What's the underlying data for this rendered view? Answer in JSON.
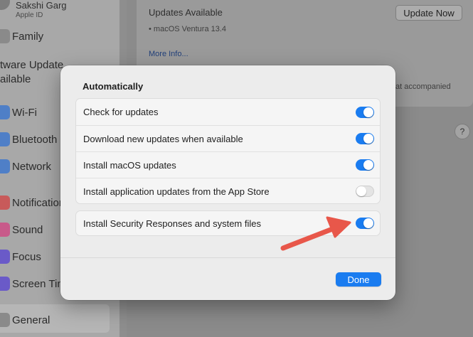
{
  "sidebar": {
    "user_name": "Sakshi Garg",
    "user_sub": "Apple ID",
    "family": "Family",
    "software_update_line1": "tware Update",
    "software_update_line2": "ailable",
    "items": [
      {
        "label": "Wi-Fi",
        "icon": "wifi-icon",
        "color": "#4f7fc7"
      },
      {
        "label": "Bluetooth",
        "icon": "bluetooth-icon",
        "color": "#4f7fc7"
      },
      {
        "label": "Network",
        "icon": "network-icon",
        "color": "#4f7fc7"
      },
      {
        "label": "Notification",
        "icon": "notifications-icon",
        "color": "#c85a5a"
      },
      {
        "label": "Sound",
        "icon": "sound-icon",
        "color": "#c85a8a"
      },
      {
        "label": "Focus",
        "icon": "focus-icon",
        "color": "#6a5ac8"
      },
      {
        "label": "Screen Tim",
        "icon": "screen-time-icon",
        "color": "#6a5ac8"
      },
      {
        "label": "General",
        "icon": "general-icon",
        "color": "#8a8a8a"
      }
    ]
  },
  "main": {
    "updates_title": "Updates Available",
    "updates_sub": "• macOS Ventura 13.4",
    "more_info": "More Info...",
    "update_now": "Update Now",
    "accompanied": "at accompanied",
    "help": "?"
  },
  "dialog": {
    "heading": "Automatically",
    "rows": [
      {
        "label": "Check for updates",
        "on": true
      },
      {
        "label": "Download new updates when available",
        "on": true
      },
      {
        "label": "Install macOS updates",
        "on": true
      },
      {
        "label": "Install application updates from the App Store",
        "on": false
      }
    ],
    "security_row": {
      "label": "Install Security Responses and system files",
      "on": true
    },
    "done": "Done"
  },
  "colors": {
    "accent": "#1a7cf0",
    "arrow": "#e8574a"
  }
}
